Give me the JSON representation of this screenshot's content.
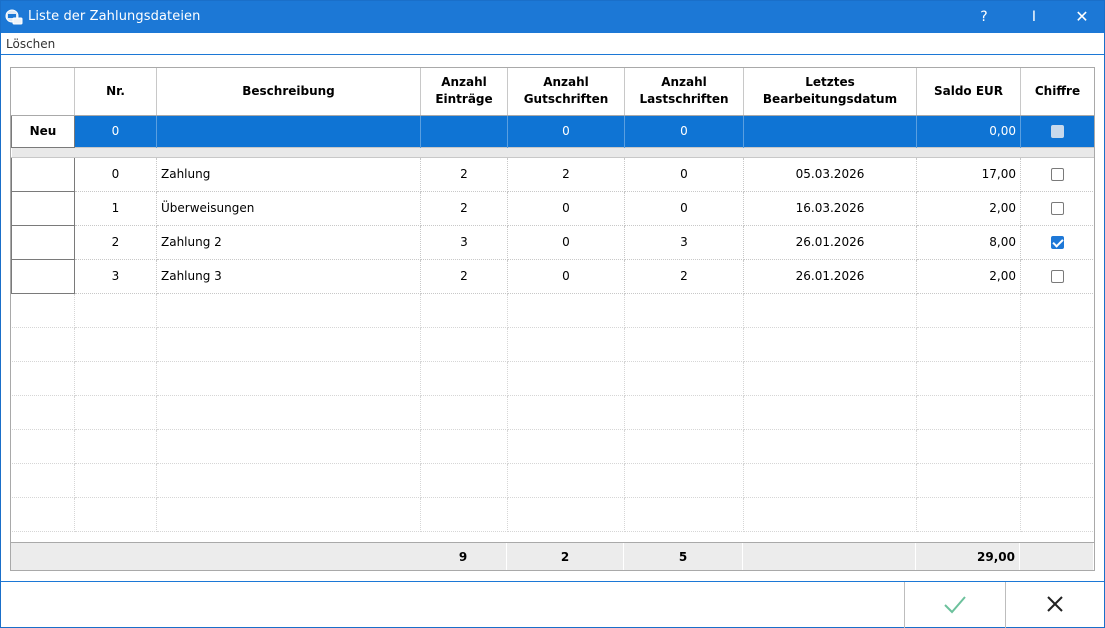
{
  "window": {
    "title": "Liste der Zahlungsdateien",
    "help_label": "?",
    "pin_label": "I",
    "close_label": "✕"
  },
  "menu": {
    "items": [
      "Löschen"
    ]
  },
  "columns": [
    "",
    "Nr.",
    "Beschreibung",
    "Anzahl\nEinträge",
    "Anzahl\nGutschriften",
    "Anzahl\nLastschriften",
    "Letztes\nBearbeitungsdatum",
    "Saldo EUR",
    "Chiffre"
  ],
  "new_row": {
    "header": "Neu",
    "nr": "0",
    "beschreibung": "",
    "eintraege": "",
    "gutschriften": "0",
    "lastschriften": "0",
    "datum": "",
    "saldo": "0,00",
    "chiffre": false
  },
  "rows": [
    {
      "nr": "0",
      "beschreibung": "Zahlung",
      "eintraege": "2",
      "gutschriften": "2",
      "lastschriften": "0",
      "datum": "05.03.2026",
      "saldo": "17,00",
      "chiffre": false
    },
    {
      "nr": "1",
      "beschreibung": "Überweisungen",
      "eintraege": "2",
      "gutschriften": "0",
      "lastschriften": "0",
      "datum": "16.03.2026",
      "saldo": "2,00",
      "chiffre": false
    },
    {
      "nr": "2",
      "beschreibung": "Zahlung 2",
      "eintraege": "3",
      "gutschriften": "0",
      "lastschriften": "3",
      "datum": "26.01.2026",
      "saldo": "8,00",
      "chiffre": true
    },
    {
      "nr": "3",
      "beschreibung": "Zahlung 3",
      "eintraege": "2",
      "gutschriften": "0",
      "lastschriften": "2",
      "datum": "26.01.2026",
      "saldo": "2,00",
      "chiffre": false
    }
  ],
  "totals": {
    "eintraege": "9",
    "gutschriften": "2",
    "lastschriften": "5",
    "saldo": "29,00"
  },
  "buttons": {
    "ok_icon": "checkmark-icon",
    "cancel_icon": "close-icon"
  },
  "colors": {
    "accent": "#1c78d6",
    "selection": "#0f74d4",
    "ok": "#6cc19c"
  }
}
